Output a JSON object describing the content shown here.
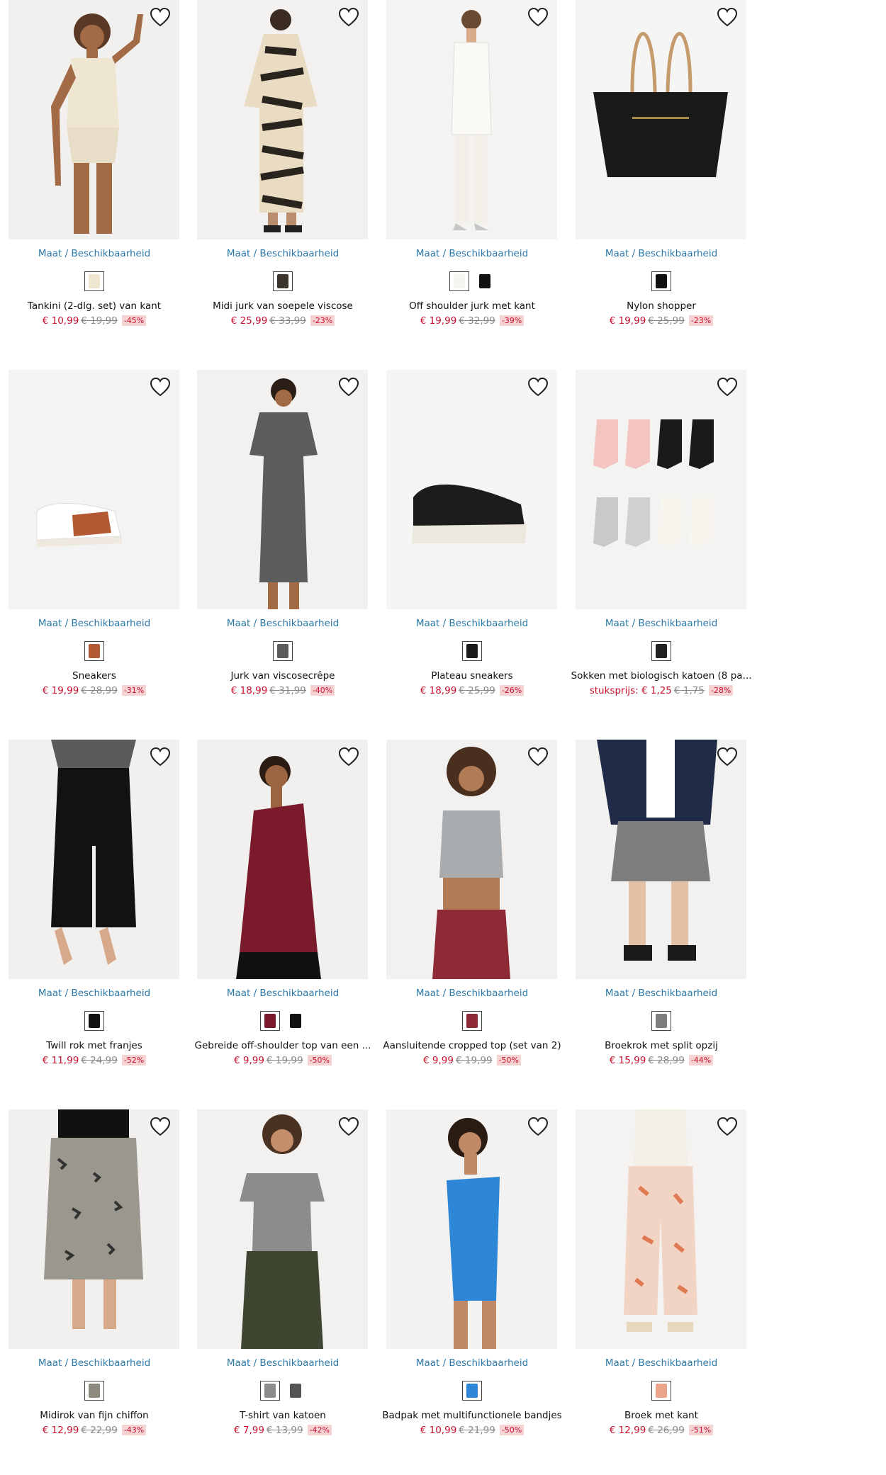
{
  "maat_label": "Maat / Beschikbaarheid",
  "colors": {
    "link": "#2d79a8",
    "sale": "#c8102e",
    "badge_bg": "#f6d3d3",
    "old_price": "#888888"
  },
  "products": [
    {
      "name": "Tankini (2-dlg. set) van kant",
      "price": "€ 10,99",
      "old_price": "€ 19,99",
      "discount": "-45%",
      "swatches": [
        "#efe6d2"
      ]
    },
    {
      "name": "Midi jurk van soepele viscose",
      "price": "€ 25,99",
      "old_price": "€ 33,99",
      "discount": "-23%",
      "swatches": [
        "#3b352d"
      ]
    },
    {
      "name": "Off shoulder jurk met kant",
      "price": "€ 19,99",
      "old_price": "€ 32,99",
      "discount": "-39%",
      "swatches": [
        "#f7f5f0",
        "#111111"
      ]
    },
    {
      "name": "Nylon shopper",
      "price": "€ 19,99",
      "old_price": "€ 25,99",
      "discount": "-23%",
      "swatches": [
        "#111111"
      ]
    },
    {
      "name": "Sneakers",
      "price": "€ 19,99",
      "old_price": "€ 28,99",
      "discount": "-31%",
      "swatches": [
        "#b35a34"
      ]
    },
    {
      "name": "Jurk van viscosecrêpe",
      "price": "€ 18,99",
      "old_price": "€ 31,99",
      "discount": "-40%",
      "swatches": [
        "#5c5c5c"
      ]
    },
    {
      "name": "Plateau sneakers",
      "price": "€ 18,99",
      "old_price": "€ 25,99",
      "discount": "-26%",
      "swatches": [
        "#1b1b1b"
      ]
    },
    {
      "name": "Sokken met biologisch katoen (8 pa...",
      "price_prefix": "stuksprijs: ",
      "price": "€ 1,25",
      "old_price": "€ 1,75",
      "discount": "-28%",
      "swatches": [
        "#222222"
      ]
    },
    {
      "name": "Twill rok met franjes",
      "price": "€ 11,99",
      "old_price": "€ 24,99",
      "discount": "-52%",
      "swatches": [
        "#111111"
      ]
    },
    {
      "name": "Gebreide off-shoulder top van een ...",
      "price": "€ 9,99",
      "old_price": "€ 19,99",
      "discount": "-50%",
      "swatches": [
        "#7a1a2a",
        "#111111"
      ]
    },
    {
      "name": "Aansluitende cropped top (set van 2)",
      "price": "€ 9,99",
      "old_price": "€ 19,99",
      "discount": "-50%",
      "swatches": [
        "#8e2a36"
      ]
    },
    {
      "name": "Broekrok met split opzij",
      "price": "€ 15,99",
      "old_price": "€ 28,99",
      "discount": "-44%",
      "swatches": [
        "#7d7d7d"
      ]
    },
    {
      "name": "Midirok van fijn chiffon",
      "price": "€ 12,99",
      "old_price": "€ 22,99",
      "discount": "-43%",
      "swatches": [
        "#8d8a80"
      ]
    },
    {
      "name": "T-shirt van katoen",
      "price": "€ 7,99",
      "old_price": "€ 13,99",
      "discount": "-42%",
      "swatches": [
        "#8c8c8c",
        "#555555"
      ]
    },
    {
      "name": "Badpak met multifunctionele bandjes",
      "price": "€ 10,99",
      "old_price": "€ 21,99",
      "discount": "-50%",
      "swatches": [
        "#2e86d6"
      ]
    },
    {
      "name": "Broek met kant",
      "price": "€ 12,99",
      "old_price": "€ 26,99",
      "discount": "-51%",
      "swatches": [
        "#e9a48a"
      ]
    }
  ]
}
